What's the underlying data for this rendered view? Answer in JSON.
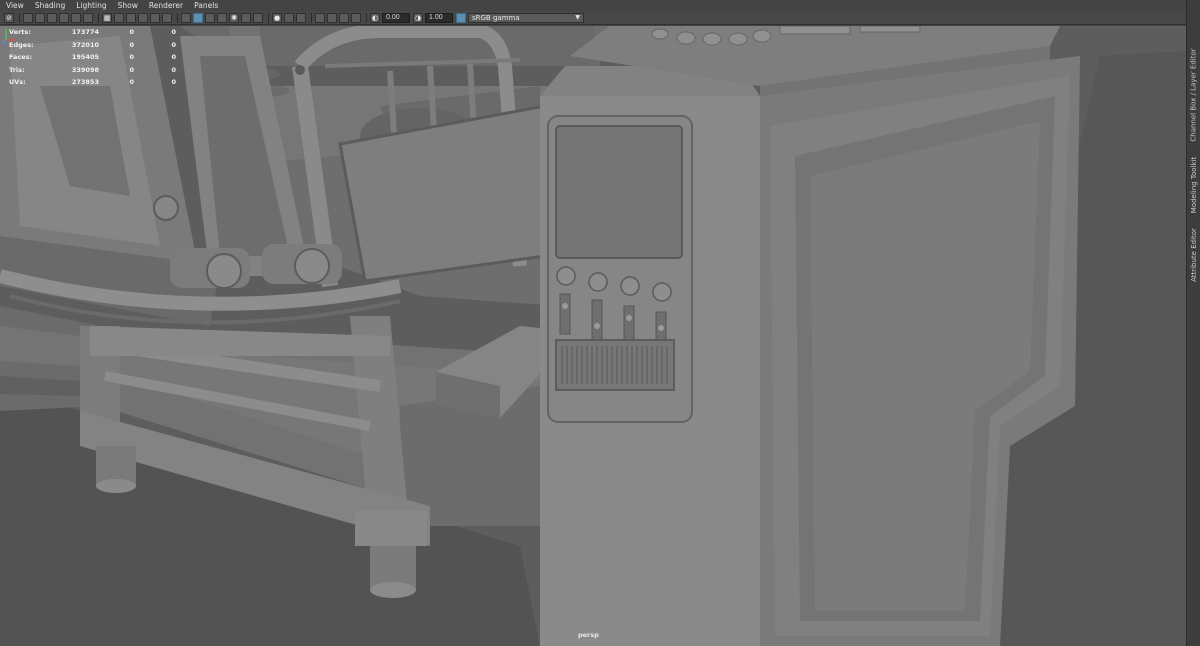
{
  "menu": [
    "View",
    "Shading",
    "Lighting",
    "Show",
    "Renderer",
    "Panels"
  ],
  "toolbar": {
    "exposure_value": "0.00",
    "gamma_value": "1.00",
    "color_space": "sRGB gamma"
  },
  "hud": {
    "rows": [
      {
        "label": "Verts:",
        "v1": "173774",
        "v2": "0",
        "v3": "0"
      },
      {
        "label": "Edges:",
        "v1": "372010",
        "v2": "0",
        "v3": "0"
      },
      {
        "label": "Faces:",
        "v1": "195405",
        "v2": "0",
        "v3": "0"
      },
      {
        "label": "Tris:",
        "v1": "339098",
        "v2": "0",
        "v3": "0"
      },
      {
        "label": "UVs:",
        "v1": "273853",
        "v2": "0",
        "v3": "0"
      }
    ]
  },
  "camera": "persp",
  "dock_tabs": [
    "Channel Box / Layer Editor",
    "Modeling Toolkit",
    "Attribute Editor"
  ],
  "icons": {
    "menu_strip": [
      "no-icon",
      "camera-icon",
      "bookmark-icon",
      "image-plane-icon",
      "grid-icon",
      "resolution-gate-icon",
      "safe-frame-icon",
      "wireframe-icon",
      "smooth-shade-icon",
      "textured-icon",
      "lights-icon",
      "shadows-icon",
      "ao-icon",
      "motion-blur-icon",
      "antialias-icon",
      "isolate-icon",
      "xray-icon",
      "exposure-icon",
      "gamma-icon",
      "color-manage-icon"
    ]
  }
}
